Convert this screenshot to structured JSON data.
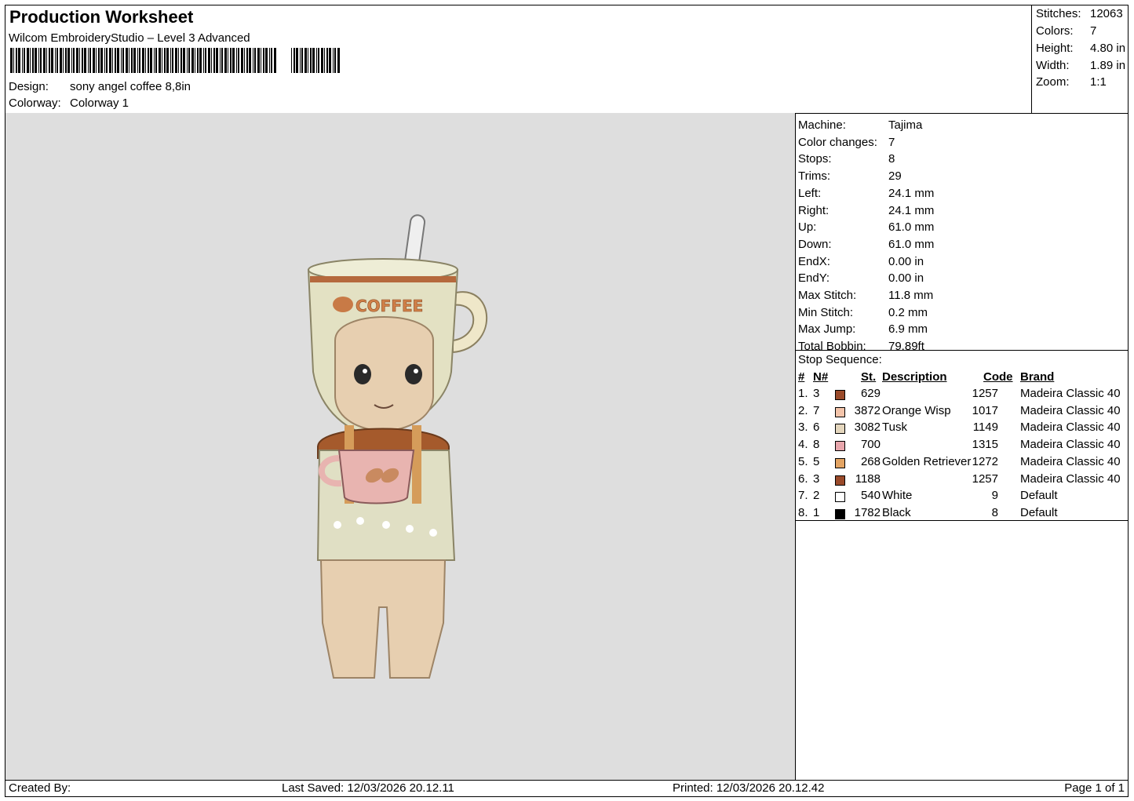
{
  "header": {
    "title": "Production Worksheet",
    "subtitle": "Wilcom EmbroideryStudio – Level 3 Advanced",
    "design_label": "Design:",
    "design_value": "sony angel coffee 8,8in",
    "colorway_label": "Colorway:",
    "colorway_value": "Colorway 1"
  },
  "stats": [
    {
      "label": "Stitches:",
      "value": "12063"
    },
    {
      "label": "Colors:",
      "value": "7"
    },
    {
      "label": "Height:",
      "value": "4.80 in"
    },
    {
      "label": "Width:",
      "value": "1.89 in"
    },
    {
      "label": "Zoom:",
      "value": "1:1"
    }
  ],
  "spec": [
    {
      "label": "Machine:",
      "value": "Tajima"
    },
    {
      "label": "Color changes:",
      "value": "7"
    },
    {
      "label": "Stops:",
      "value": "8"
    },
    {
      "label": "Trims:",
      "value": "29"
    },
    {
      "label": "Left:",
      "value": "24.1 mm"
    },
    {
      "label": "Right:",
      "value": "24.1 mm"
    },
    {
      "label": "Up:",
      "value": "61.0 mm"
    },
    {
      "label": "Down:",
      "value": "61.0 mm"
    },
    {
      "label": "EndX:",
      "value": "0.00 in"
    },
    {
      "label": "EndY:",
      "value": "0.00 in"
    },
    {
      "label": "Max Stitch:",
      "value": "11.8 mm"
    },
    {
      "label": "Min Stitch:",
      "value": "0.2 mm"
    },
    {
      "label": "Max Jump:",
      "value": "6.9 mm"
    },
    {
      "label": "Total Bobbin:",
      "value": "79.89ft"
    }
  ],
  "stop_sequence": {
    "caption": "Stop Sequence:",
    "headers": {
      "idx": "#",
      "n": "N#",
      "st": "St.",
      "desc": "Description",
      "code": "Code",
      "brand": "Brand"
    },
    "rows": [
      {
        "idx": "1.",
        "n": "3",
        "color": "#9a4a2a",
        "st": "629",
        "desc": "",
        "code": "1257",
        "brand": "Madeira Classic 40"
      },
      {
        "idx": "2.",
        "n": "7",
        "color": "#f3c4aa",
        "st": "3872",
        "desc": "Orange Wisp",
        "code": "1017",
        "brand": "Madeira Classic 40"
      },
      {
        "idx": "3.",
        "n": "6",
        "color": "#e4d6bd",
        "st": "3082",
        "desc": "Tusk",
        "code": "1149",
        "brand": "Madeira Classic 40"
      },
      {
        "idx": "4.",
        "n": "8",
        "color": "#e8a6ac",
        "st": "700",
        "desc": "",
        "code": "1315",
        "brand": "Madeira Classic 40"
      },
      {
        "idx": "5.",
        "n": "5",
        "color": "#e3a463",
        "st": "268",
        "desc": "Golden Retriever",
        "code": "1272",
        "brand": "Madeira Classic 40"
      },
      {
        "idx": "6.",
        "n": "3",
        "color": "#9a4a2a",
        "st": "1188",
        "desc": "",
        "code": "1257",
        "brand": "Madeira Classic 40"
      },
      {
        "idx": "7.",
        "n": "2",
        "color": "#ffffff",
        "st": "540",
        "desc": "White",
        "code": "9",
        "brand": "Default"
      },
      {
        "idx": "8.",
        "n": "1",
        "color": "#000000",
        "st": "1782",
        "desc": "Black",
        "code": "8",
        "brand": "Default"
      }
    ]
  },
  "design_preview": {
    "mug_text": "COFFEE"
  },
  "footer": {
    "created_by": "Created By:",
    "last_saved": "Last Saved: 12/03/2026 20.12.11",
    "printed": "Printed: 12/03/2026 20.12.42",
    "page": "Page 1 of 1"
  }
}
